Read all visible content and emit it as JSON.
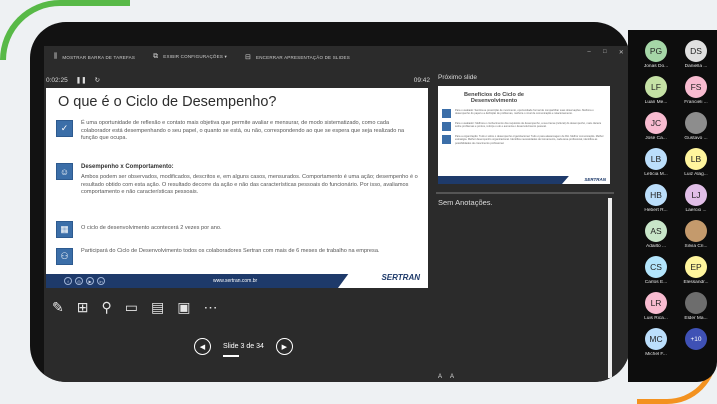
{
  "colors": {
    "brand_navy": "#1e3a6a",
    "slide_icon_blue": "#3b6ea8",
    "deco_green": "#58b947",
    "deco_orange": "#f39220"
  },
  "toolbar": {
    "taskbar": "MOSTRAR BARRA DE TAREFAS",
    "display": "EXIBIR CONFIGURAÇÕES ▾",
    "end": "ENCERRAR APRESENTAÇÃO DE SLIDES"
  },
  "timer": {
    "elapsed": "0:02:25",
    "pause_icon": "pause-icon",
    "reset_icon": "reset-icon",
    "clock": "09:42"
  },
  "slide": {
    "title": "O que é o Ciclo de Desempenho?",
    "items": [
      {
        "icon": "checkmark-icon",
        "heading": "",
        "text": "É uma oportunidade de reflexão e contato mais objetiva que permite avaliar e mensurar, de modo sistematizado, como cada colaborador está desempenhando o seu papel, o quanto se está, ou não, correspondendo ao que se espera que seja realizado na função que ocupa."
      },
      {
        "icon": "person-icon",
        "heading": "Desempenho x Comportamento:",
        "text": "Ambos podem ser observados, modificados, descritos e, em alguns casos, mensurados. Comportamento é uma ação; desempenho é o resultado obtido com esta ação. O resultado decorre da ação e não das características pessoais do funcionário. Por isso, avaliamos comportamento e não características pessoais."
      },
      {
        "icon": "calendar-icon",
        "heading": "",
        "text": "O ciclo de desenvolvimento acontecerá 2 vezes por ano."
      },
      {
        "icon": "team-icon",
        "heading": "",
        "text": "Participará do Ciclo de Desenvolvimento todos os colaboradores Sertran com mais de 6 meses de trabalho na empresa."
      }
    ],
    "footer_url": "www.sertran.com.br",
    "footer_logo": "SERTRAN"
  },
  "next": {
    "label": "Próximo slide",
    "title": "Benefícios do Ciclo de Desenvolvimento",
    "rows": [
      "Para o avaliado: Sentirá-se prescrição de movimento, oportunidade formal de compartilhar suas observações. Melhora o desempenho do papel e a definição de problemas, melhora o nível de comunicação e relacionamento.",
      "Para o avaliador: Melhora o conhecimento dos requisitos de desempenho, a sua trama (cultural) do desempenho, mais clareza sobre problemas e pontos, reforça o elo e aumenta o desenvolvimento pessoal.",
      "Para a organização: Tudo é sobre o desempenho organizacional. Tudo é para alavancagem de RH. Melhor comunicação. Melhor estratégia. Melhor desempenho organizacional. Identifica necessidades de treinamento, cada área profissional, identifica as possibilidades de crescimento profissional."
    ],
    "logo": "SERTRAN"
  },
  "notes": {
    "label": "Sem Anotações.",
    "font_up": "A",
    "font_down": "A"
  },
  "nav": {
    "slide_text": "Slide 3 de 34",
    "current_slide": 3,
    "total_slides": 34
  },
  "participants": [
    {
      "initials": "PG",
      "name": "Jonas Do...",
      "color": "#a5d6a7"
    },
    {
      "initials": "DS",
      "name": "Daniella ...",
      "color": "#e0e0e0"
    },
    {
      "initials": "LF",
      "name": "Luan Me...",
      "color": "#c5e1a5"
    },
    {
      "initials": "FS",
      "name": "Francieli ...",
      "color": "#f8bbd0"
    },
    {
      "initials": "JC",
      "name": "José Ca...",
      "color": "#f8bbd0"
    },
    {
      "initials": "",
      "name": "Gustavo ...",
      "color": "#8d8d8d"
    },
    {
      "initials": "LB",
      "name": "Letícia M...",
      "color": "#bbdefb"
    },
    {
      "initials": "LB",
      "name": "Luiz Alag...",
      "color": "#fff59d"
    },
    {
      "initials": "HB",
      "name": "Hebert R...",
      "color": "#bbdefb"
    },
    {
      "initials": "LJ",
      "name": "Laercio ...",
      "color": "#e1bee7"
    },
    {
      "initials": "AS",
      "name": "Adailto ...",
      "color": "#c8e6c9"
    },
    {
      "initials": "",
      "name": "Silvia Cri...",
      "color": "#c49a6c"
    },
    {
      "initials": "CS",
      "name": "Carlos E...",
      "color": "#b3e5fc"
    },
    {
      "initials": "EP",
      "name": "Elessandr...",
      "color": "#fff59d"
    },
    {
      "initials": "LR",
      "name": "Luis Rica...",
      "color": "#f8bbd0"
    },
    {
      "initials": "",
      "name": "Elder Ma...",
      "color": "#6d6d6d"
    },
    {
      "initials": "MC",
      "name": "Michel F...",
      "color": "#bbdefb"
    },
    {
      "initials": "+10",
      "name": "",
      "color": "#3f51b5"
    }
  ]
}
